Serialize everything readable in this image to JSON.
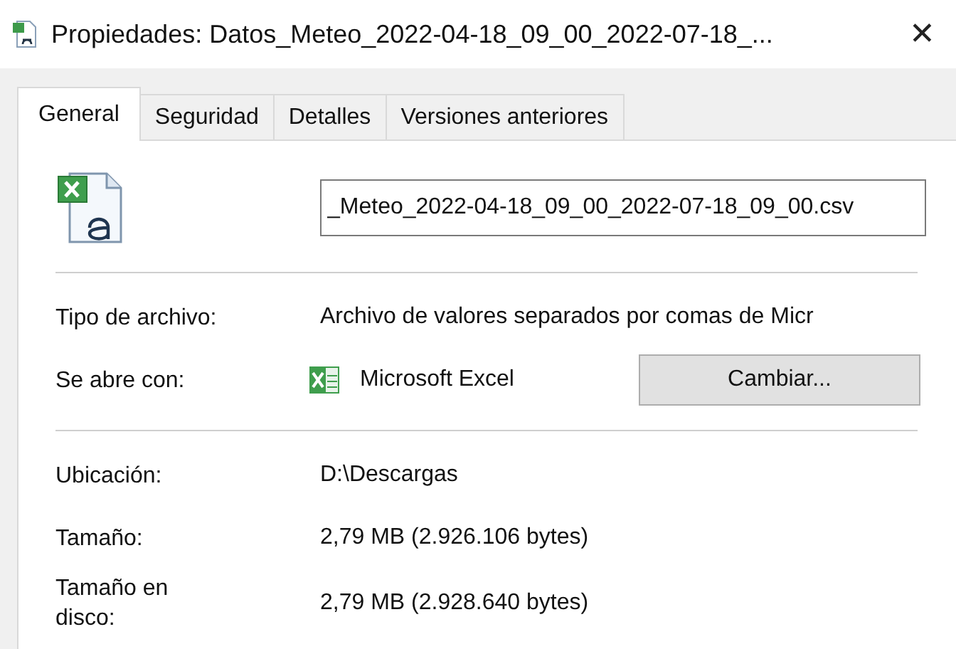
{
  "window": {
    "title": "Propiedades: Datos_Meteo_2022-04-18_09_00_2022-07-18_...",
    "close": "✕"
  },
  "tabs": [
    {
      "label": "General",
      "selected": true
    },
    {
      "label": "Seguridad",
      "selected": false
    },
    {
      "label": "Detalles",
      "selected": false
    },
    {
      "label": "Versiones anteriores",
      "selected": false
    }
  ],
  "file_name": {
    "value": "_Meteo_2022-04-18_09_00_2022-07-18_09_00.csv"
  },
  "sections": [
    [
      {
        "kind": "text",
        "label": "Tipo de archivo:",
        "value": "Archivo de valores separados por comas de Micr"
      },
      {
        "kind": "app",
        "label": "Se abre con:",
        "value": "Microsoft Excel",
        "button": "Cambiar..."
      }
    ],
    [
      {
        "kind": "text",
        "label": "Ubicación:",
        "value": "D:\\Descargas"
      },
      {
        "kind": "text",
        "label": "Tamaño:",
        "value": "2,79 MB (2.926.106 bytes)"
      },
      {
        "kind": "text",
        "label": "Tamaño en disco:",
        "value": "2,79 MB (2.928.640 bytes)"
      }
    ]
  ]
}
